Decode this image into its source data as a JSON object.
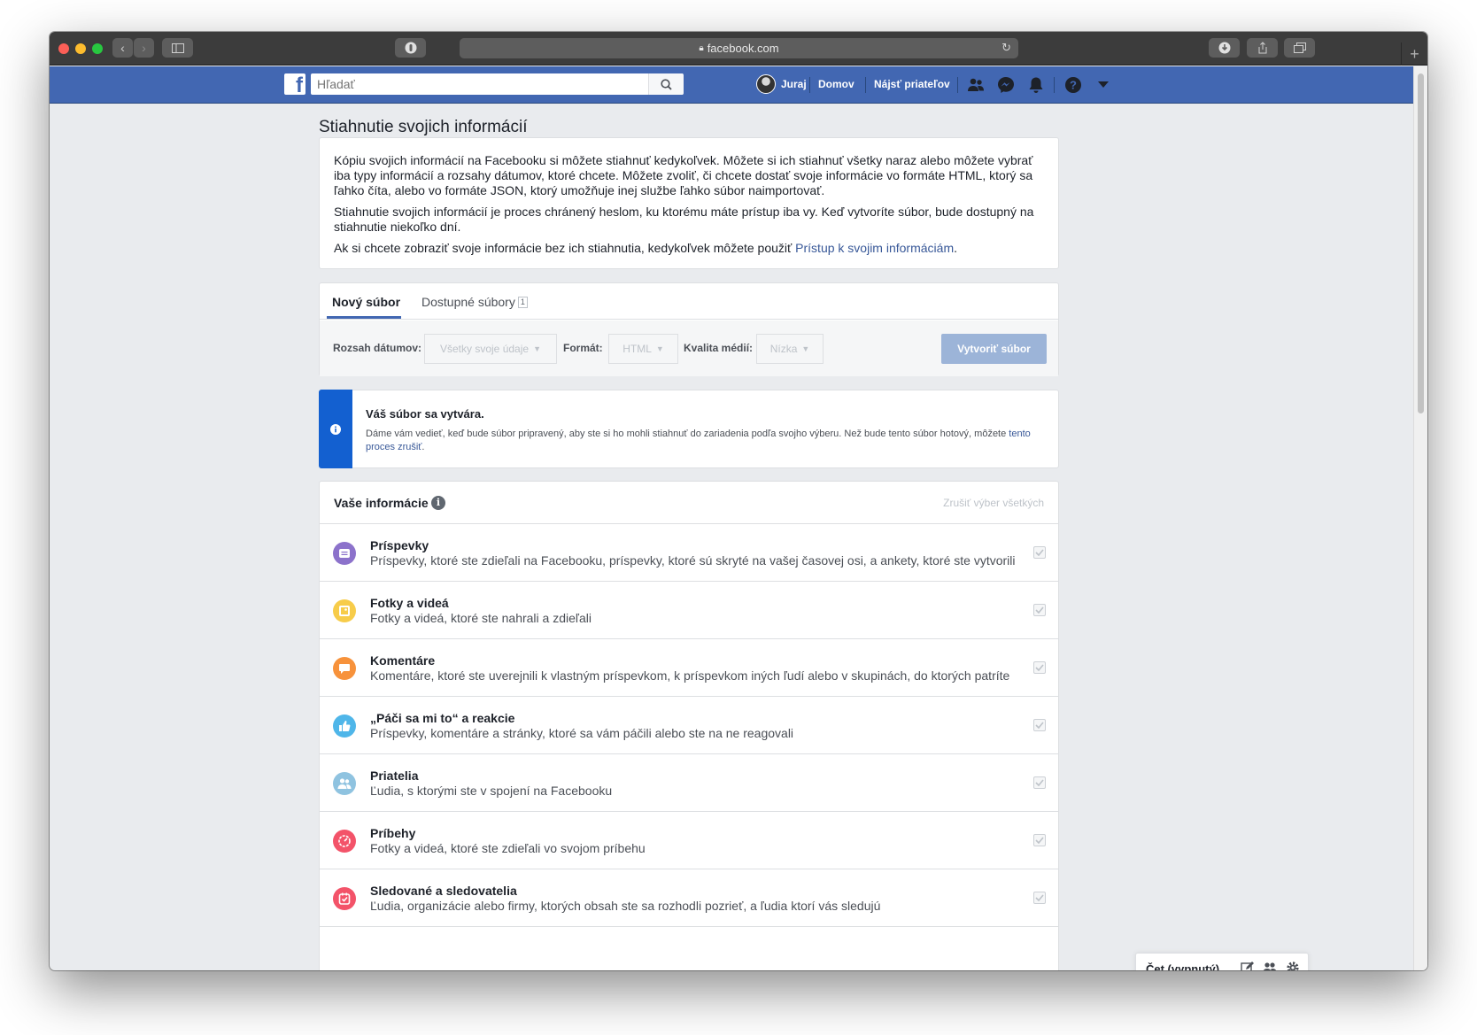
{
  "browser": {
    "url": "facebook.com"
  },
  "header": {
    "search_placeholder": "Hľadať",
    "profile_name": "Juraj",
    "home_label": "Domov",
    "find_friends_label": "Nájsť priateľov"
  },
  "page": {
    "title": "Stiahnutie svojich informácií",
    "intro_p1": "Kópiu svojich informácií na Facebooku si môžete stiahnuť kedykoľvek. Môžete si ich stiahnuť všetky naraz alebo môžete vybrať iba typy informácií a rozsahy dátumov, ktoré chcete. Môžete zvoliť, či chcete dostať svoje informácie vo formáte HTML, ktorý sa ľahko číta, alebo vo formáte JSON, ktorý umožňuje inej službe ľahko súbor naimportovať.",
    "intro_p2": "Stiahnutie svojich informácií je proces chránený heslom, ku ktorému máte prístup iba vy. Keď vytvoríte súbor, bude dostupný na stiahnutie niekoľko dní.",
    "intro_p3_prefix": "Ak si chcete zobraziť svoje informácie bez ich stiahnutia, kedykoľvek môžete použiť ",
    "intro_p3_link": "Prístup k svojim informáciám",
    "intro_p3_suffix": "."
  },
  "tabs": {
    "new_file": "Nový súbor",
    "available_files": "Dostupné súbory",
    "available_count": "1"
  },
  "filters": {
    "date_range_label": "Rozsah dátumov:",
    "date_range_value": "Všetky svoje údaje",
    "format_label": "Formát:",
    "format_value": "HTML",
    "media_quality_label": "Kvalita médií:",
    "media_quality_value": "Nízka",
    "create_button": "Vytvoriť súbor"
  },
  "notice": {
    "title": "Váš súbor sa vytvára.",
    "text_prefix": "Dáme vám vedieť, keď bude súbor pripravený, aby ste si ho mohli stiahnuť do zariadenia podľa svojho výberu. Než bude tento súbor hotový, môžete ",
    "cancel_link": "tento proces zrušiť",
    "text_suffix": "."
  },
  "info": {
    "title": "Vaše informácie",
    "deselect_all": "Zrušiť výber všetkých",
    "categories": [
      {
        "title": "Príspevky",
        "desc": "Príspevky, ktoré ste zdieľali na Facebooku, príspevky, ktoré sú skryté na vašej časovej osi, a ankety, ktoré ste vytvorili",
        "icon": "posts-icon",
        "color": "#8c72cb"
      },
      {
        "title": "Fotky a videá",
        "desc": "Fotky a videá, ktoré ste nahrali a zdieľali",
        "icon": "photos-icon",
        "color": "#f7cc4a"
      },
      {
        "title": "Komentáre",
        "desc": "Komentáre, ktoré ste uverejnili k vlastným príspevkom, k príspevkom iných ľudí alebo v skupinách, do ktorých patríte",
        "icon": "comment-icon",
        "color": "#f7923b"
      },
      {
        "title": "„Páči sa mi to“ a reakcie",
        "desc": "Príspevky, komentáre a stránky, ktoré sa vám páčili alebo ste na ne reagovali",
        "icon": "thumbs-up-icon",
        "color": "#4fb6e9"
      },
      {
        "title": "Priatelia",
        "desc": "Ľudia, s ktorými ste v spojení na Facebooku",
        "icon": "friends-icon",
        "color": "#8fc3e0"
      },
      {
        "title": "Príbehy",
        "desc": "Fotky a videá, ktoré ste zdieľali vo svojom príbehu",
        "icon": "stories-icon",
        "color": "#f35369"
      },
      {
        "title": "Sledované a sledovatelia",
        "desc": "Ľudia, organizácie alebo firmy, ktorých obsah ste sa rozhodli pozrieť, a ľudia ktorí vás sledujú",
        "icon": "following-icon",
        "color": "#f35369"
      }
    ]
  },
  "chat": {
    "label": "Čet (vypnutý)"
  }
}
